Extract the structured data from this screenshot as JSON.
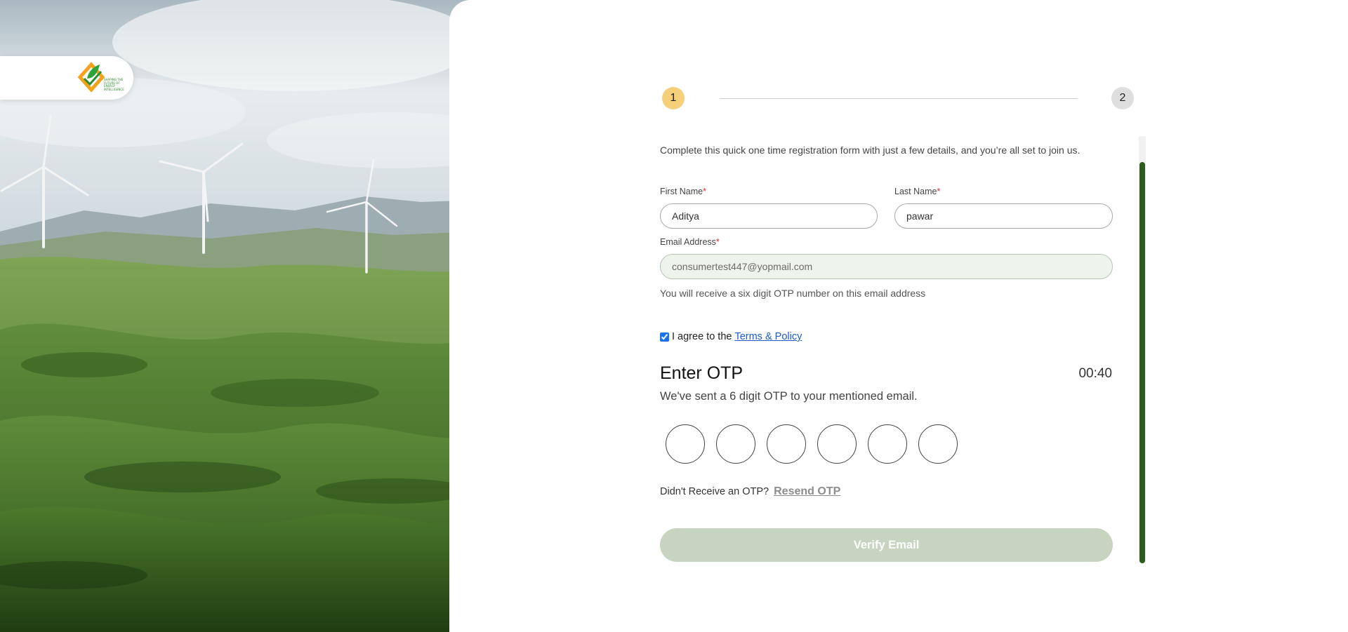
{
  "brand": {
    "logo_text": "SHAPING THE FUTURE OF ENERGY INTELLIGENCE"
  },
  "stepper": {
    "step1": "1",
    "step2": "2",
    "active_step": 1
  },
  "form": {
    "intro": "Complete this quick one time registration form with just a few details, and you’re all set to join us.",
    "first_name_label": "First Name",
    "first_name_value": "Aditya",
    "last_name_label": "Last Name",
    "last_name_value": "pawar",
    "email_label": "Email Address",
    "email_value": "consumertest447@yopmail.com",
    "required_mark": "*",
    "email_hint": "You will receive a six digit OTP number on this email address",
    "agree_text": "I agree to the",
    "terms_link": "Terms & Policy",
    "agree_checked": true
  },
  "otp": {
    "title": "Enter OTP",
    "timer": "00:40",
    "subtitle": "We've sent a 6 digit OTP to your mentioned email.",
    "digits": [
      "",
      "",
      "",
      "",
      "",
      ""
    ],
    "resend_prompt": "Didn't Receive an OTP?",
    "resend_link": "Resend OTP"
  },
  "actions": {
    "verify_label": "Verify Email"
  },
  "colors": {
    "step_active": "#f5cf7a",
    "step_inactive": "#dedede",
    "scroll_thumb": "#2e5b1e",
    "verify_disabled": "#c6d4c0",
    "link": "#1a5dc9"
  }
}
